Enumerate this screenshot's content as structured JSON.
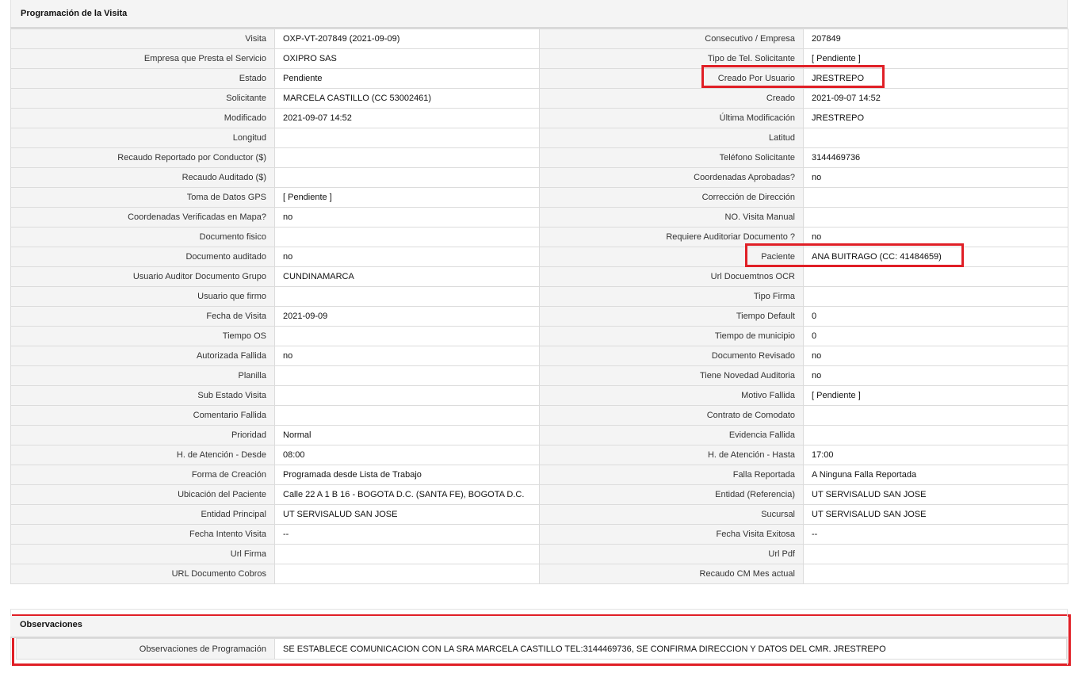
{
  "section_title": "Programación de la Visita",
  "rows": [
    {
      "l1": "Visita",
      "v1": "OXP-VT-207849 (2021-09-09)",
      "l2": "Consecutivo / Empresa",
      "v2": "207849"
    },
    {
      "l1": "Empresa que Presta el Servicio",
      "v1": "OXIPRO SAS",
      "l2": "Tipo de Tel. Solicitante",
      "v2": "[ Pendiente ]"
    },
    {
      "l1": "Estado",
      "v1": "Pendiente",
      "l2": "Creado Por Usuario",
      "v2": "JRESTREPO"
    },
    {
      "l1": "Solicitante",
      "v1": "MARCELA CASTILLO (CC 53002461)",
      "l2": "Creado",
      "v2": "2021-09-07 14:52"
    },
    {
      "l1": "Modificado",
      "v1": "2021-09-07 14:52",
      "l2": "Última Modificación",
      "v2": " JRESTREPO"
    },
    {
      "l1": "Longitud",
      "v1": "",
      "l2": "Latitud",
      "v2": ""
    },
    {
      "l1": "Recaudo Reportado por Conductor ($)",
      "v1": "",
      "l2": "Teléfono Solicitante",
      "v2": "3144469736"
    },
    {
      "l1": "Recaudo Auditado ($)",
      "v1": "",
      "l2": "Coordenadas Aprobadas?",
      "v2": " no"
    },
    {
      "l1": "Toma de Datos GPS",
      "v1": "[ Pendiente ]",
      "l2": "Corrección de Dirección",
      "v2": ""
    },
    {
      "l1": "Coordenadas Verificadas en Mapa?",
      "v1": " no",
      "l2": "NO. Visita Manual",
      "v2": ""
    },
    {
      "l1": "Documento fisico",
      "v1": "",
      "l2": "Requiere Auditoriar Documento ?",
      "v2": " no"
    },
    {
      "l1": "Documento auditado",
      "v1": " no",
      "l2": "Paciente",
      "v2": "ANA BUITRAGO (CC: 41484659)"
    },
    {
      "l1": "Usuario Auditor Documento Grupo",
      "v1": "CUNDINAMARCA",
      "l2": "Url Docuemtnos OCR",
      "v2": ""
    },
    {
      "l1": "Usuario que firmo",
      "v1": "",
      "l2": "Tipo Firma",
      "v2": ""
    },
    {
      "l1": "Fecha de Visita",
      "v1": " 2021-09-09",
      "l2": "Tiempo Default",
      "v2": "0"
    },
    {
      "l1": "Tiempo OS",
      "v1": "",
      "l2": "Tiempo de municipio",
      "v2": "0"
    },
    {
      "l1": "Autorizada Fallida",
      "v1": " no",
      "l2": "Documento Revisado",
      "v2": " no"
    },
    {
      "l1": "Planilla",
      "v1": "",
      "l2": "Tiene Novedad Auditoria",
      "v2": " no"
    },
    {
      "l1": "Sub Estado Visita",
      "v1": "",
      "l2": "Motivo Fallida",
      "v2": "[ Pendiente ]"
    },
    {
      "l1": "Comentario Fallida",
      "v1": "",
      "l2": "Contrato de Comodato",
      "v2": ""
    },
    {
      "l1": "Prioridad",
      "v1": "Normal",
      "l2": "Evidencia Fallida",
      "v2": ""
    },
    {
      "l1": "H. de Atención - Desde",
      "v1": "08:00",
      "l2": "H. de Atención - Hasta",
      "v2": "17:00"
    },
    {
      "l1": "Forma de Creación",
      "v1": "Programada desde Lista de Trabajo",
      "l2": "Falla Reportada",
      "v2": "A Ninguna Falla Reportada"
    },
    {
      "l1": "Ubicación del Paciente",
      "v1": "Calle 22 A 1 B 16 - BOGOTA D.C. (SANTA FE), BOGOTA D.C.",
      "l2": "Entidad (Referencia)",
      "v2": "UT SERVISALUD SAN JOSE"
    },
    {
      "l1": "Entidad Principal",
      "v1": "UT SERVISALUD SAN JOSE",
      "l2": "Sucursal",
      "v2": "UT SERVISALUD SAN JOSE"
    },
    {
      "l1": "Fecha Intento Visita",
      "v1": " --",
      "l2": "Fecha Visita Exitosa",
      "v2": " --"
    },
    {
      "l1": "Url Firma",
      "v1": "",
      "l2": "Url Pdf",
      "v2": ""
    },
    {
      "l1": "URL Documento Cobros",
      "v1": "",
      "l2": "Recaudo CM Mes actual",
      "v2": ""
    }
  ],
  "observaciones": {
    "title": "Observaciones",
    "label": "Observaciones de Programación",
    "value": " SE ESTABLECE COMUNICACION CON LA SRA MARCELA CASTILLO TEL:3144469736, SE CONFIRMA DIRECCION Y DATOS DEL CMR. JRESTREPO"
  },
  "colors": {
    "highlight": "#e01f26",
    "label_bg": "#f4f4f4",
    "border": "#dcdcdc"
  }
}
